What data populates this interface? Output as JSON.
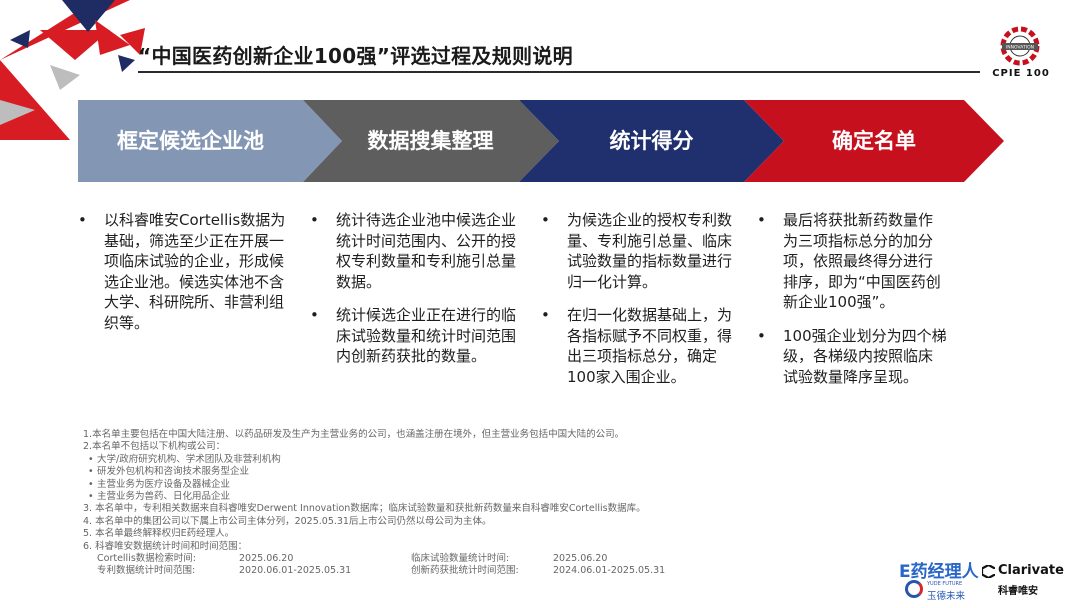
{
  "title": "“中国医药创新企业100强”评选过程及规则说明",
  "logo": {
    "brand_text": "CPIE 100",
    "badge_text": "INNOVATION"
  },
  "colors": {
    "step1": "#8397b4",
    "step2": "#5e5e5e",
    "step3": "#20306e",
    "step4": "#c7101e",
    "deco_red": "#d81c24",
    "deco_navy": "#1f2b63"
  },
  "steps": [
    {
      "label": "框定候选企业池"
    },
    {
      "label": "数据搜集整理"
    },
    {
      "label": "统计得分"
    },
    {
      "label": "确定名单"
    }
  ],
  "columns": [
    {
      "bullets": [
        "以科睿唯安Cortellis数据为基础，筛选至少正在开展一项临床试验的企业，形成候选企业池。候选实体池不含大学、科研院所、非营利组织等。"
      ]
    },
    {
      "bullets": [
        "统计待选企业池中候选企业统计时间范围内、公开的授权专利数量和专利施引总量数据。",
        "统计候选企业正在进行的临床试验数量和统计时间范围内创新药获批的数量。"
      ]
    },
    {
      "bullets": [
        "为候选企业的授权专利数量、专利施引总量、临床试验数量的指标数量进行归一化计算。",
        "在归一化数据基础上，为各指标赋予不同权重，得出三项指标总分，确定100家入围企业。"
      ]
    },
    {
      "bullets": [
        "最后将获批新药数量作为三项指标总分的加分项，依照最终得分进行排序，即为“中国医药创新企业100强”。",
        "100强企业划分为四个梯级，各梯级内按照临床试验数量降序呈现。"
      ]
    }
  ],
  "notes": {
    "n1": "1.本名单主要包括在中国大陆注册、以药品研发及生产为主营业务的公司，也涵盖注册在境外，但主营业务包括中国大陆的公司。",
    "n2": "2.本名单不包括以下机构或公司：",
    "n2_items": [
      "大学/政府研究机构、学术团队及非营利机构",
      "研发外包机构和咨询技术服务型企业",
      "主营业务为医疗设备及器械企业",
      "主营业务为兽药、日化用品企业"
    ],
    "n3": "3. 本名单中，专利相关数据来自科睿唯安Derwent Innovation数据库；临床试验数量和获批新药数量来自科睿唯安Cortellis数据库。",
    "n4": "4. 本名单中的集团公司以下属上市公司主体分列，2025.05.31后上市公司仍然以母公司为主体。",
    "n5": "5. 本名单最终解释权归E药经理人。",
    "n6": "6. 科睿唯安数据统计时间和时间范围：",
    "rows": [
      [
        "Cortellis数据检索时间:",
        "2025.06.20",
        "临床试验数量统计时间:",
        "2025.06.20"
      ],
      [
        "专利数据统计时间范围:",
        "2020.06.01-2025.05.31",
        "创新药获批统计时间范围:",
        "2024.06.01-2025.05.31"
      ]
    ]
  },
  "footer_logos": {
    "ey": "E药经理人",
    "yude_en": "YUDE FUTURE",
    "yude_cn": "玉德未来",
    "clarivate_en": "Clarivate",
    "clarivate_cn": "科睿唯安"
  }
}
